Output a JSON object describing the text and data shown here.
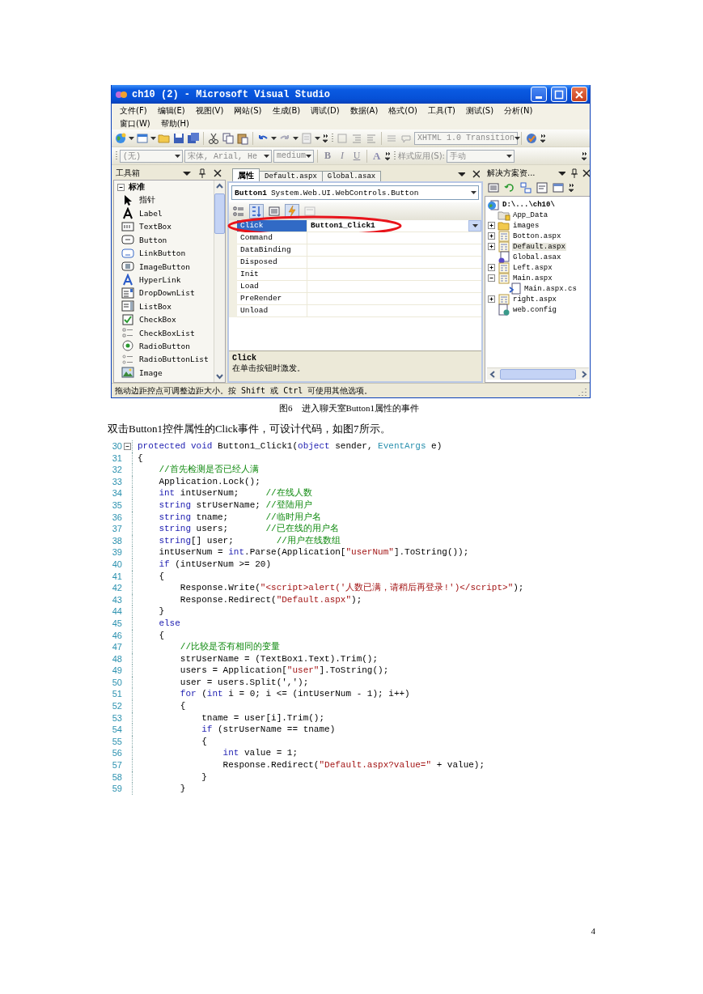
{
  "window": {
    "title": "ch10 (2) - Microsoft Visual Studio",
    "menu_rows": [
      [
        "文件(F)",
        "编辑(E)",
        "视图(V)",
        "网站(S)",
        "生成(B)",
        "调试(D)",
        "数据(A)",
        "格式(O)",
        "工具(T)",
        "测试(S)",
        "分析(N)"
      ],
      [
        "窗口(W)",
        "帮助(H)"
      ]
    ],
    "toolbar": {
      "doctype": {
        "text": "XHTML 1.0 Transition",
        "disabled": true
      }
    },
    "format_bar": {
      "block": {
        "text": "(无)",
        "disabled": true
      },
      "font": {
        "text": "宋体, Arial, He",
        "disabled": true
      },
      "size": {
        "text": "medium",
        "disabled": true
      },
      "buttons": [
        {
          "kind": "bold",
          "label": "B",
          "disabled": true
        },
        {
          "kind": "italic",
          "label": "I",
          "disabled": true
        },
        {
          "kind": "underline",
          "label": "U",
          "disabled": true
        }
      ],
      "font_color": "A",
      "style_label": "样式应用(S):",
      "style_mode": {
        "text": "手动",
        "disabled": true
      }
    },
    "toolbox": {
      "title": "工具箱",
      "group": {
        "label": "标准",
        "expanded": true
      },
      "items": [
        {
          "label": "指针",
          "kind": "pointer"
        },
        {
          "label": "Label",
          "kind": "label"
        },
        {
          "label": "TextBox",
          "kind": "textbox"
        },
        {
          "label": "Button",
          "kind": "button"
        },
        {
          "label": "LinkButton",
          "kind": "linkbutton"
        },
        {
          "label": "ImageButton",
          "kind": "imagebutton"
        },
        {
          "label": "HyperLink",
          "kind": "hyperlink"
        },
        {
          "label": "DropDownList",
          "kind": "dropdownlist"
        },
        {
          "label": "ListBox",
          "kind": "listbox"
        },
        {
          "label": "CheckBox",
          "kind": "checkbox"
        },
        {
          "label": "CheckBoxList",
          "kind": "checkboxlist"
        },
        {
          "label": "RadioButton",
          "kind": "radiobutton"
        },
        {
          "label": "RadioButtonList",
          "kind": "radiobuttonlist"
        },
        {
          "label": "Image",
          "kind": "image"
        }
      ]
    },
    "properties": {
      "tabs": [
        {
          "label": "属性",
          "selected": true
        },
        {
          "label": "Default.aspx",
          "selected": false
        },
        {
          "label": "Global.asax",
          "selected": false
        }
      ],
      "object": {
        "name": "Button1",
        "type": "System.Web.UI.WebControls.Button"
      },
      "toolbar": [
        {
          "kind": "categorized",
          "selected": false,
          "disabled": false
        },
        {
          "kind": "alphabetical",
          "selected": true,
          "disabled": false
        },
        {
          "kind": "properties",
          "selected": false,
          "disabled": false
        },
        {
          "kind": "events",
          "selected": true,
          "disabled": false
        },
        {
          "kind": "property-pages",
          "selected": false,
          "disabled": true
        }
      ],
      "rows": [
        {
          "name": "Click",
          "value": "Button1_Click1",
          "selected": true,
          "circled": true
        },
        {
          "name": "Command",
          "selected": false,
          "circled": false
        },
        {
          "name": "DataBinding",
          "selected": false,
          "circled": false
        },
        {
          "name": "Disposed",
          "selected": false,
          "circled": false
        },
        {
          "name": "Init",
          "selected": false,
          "circled": false
        },
        {
          "name": "Load",
          "selected": false,
          "circled": false
        },
        {
          "name": "PreRender",
          "selected": false,
          "circled": false
        },
        {
          "name": "Unload",
          "selected": false,
          "circled": false
        }
      ],
      "description": {
        "title": "Click",
        "text": "在单击按钮时激发。"
      }
    },
    "solution_explorer": {
      "title": "解决方案资...",
      "root": {
        "label": "D:\\...\\ch10\\",
        "kind": "project",
        "selected": false,
        "children": [
          {
            "label": "App_Data",
            "kind": "data-folder",
            "selected": false
          },
          {
            "label": "images",
            "kind": "folder",
            "expanded": false,
            "selected": false
          },
          {
            "label": "Botton.aspx",
            "kind": "page",
            "expanded": false,
            "selected": false
          },
          {
            "label": "Default.aspx",
            "kind": "page",
            "expanded": false,
            "selected": true
          },
          {
            "label": "Global.asax",
            "kind": "global",
            "selected": false
          },
          {
            "label": "Left.aspx",
            "kind": "page",
            "expanded": false,
            "selected": false
          },
          {
            "label": "Main.aspx",
            "kind": "page",
            "expanded": true,
            "selected": false,
            "children": [
              {
                "label": "Main.aspx.cs",
                "kind": "code",
                "selected": false
              }
            ]
          },
          {
            "label": "right.aspx",
            "kind": "page",
            "expanded": false,
            "selected": false
          },
          {
            "label": "web.config",
            "kind": "config",
            "selected": false
          }
        ]
      }
    },
    "status_bar": "拖动边距控点可调整边距大小。按 Shift 或 Ctrl 可使用其他选项。"
  },
  "caption": "图6　进入聊天室Button1属性的事件",
  "paragraph": "双击Button1控件属性的Click事件，可设计代码，如图7所示。",
  "code": {
    "lines": [
      {
        "number": "30",
        "fold": true,
        "tokens": [
          {
            "kind": "keyword",
            "text": "protected"
          },
          {
            "kind": "keyword",
            "text": " void"
          },
          {
            "kind": "plain",
            "text": " Button1_Click1("
          },
          {
            "kind": "keyword",
            "text": "object"
          },
          {
            "kind": "plain",
            "text": " sender, "
          },
          {
            "kind": "type",
            "text": "EventArgs"
          },
          {
            "kind": "plain",
            "text": " e)"
          }
        ]
      },
      {
        "number": "31",
        "tokens": [
          {
            "kind": "plain",
            "text": "{"
          }
        ]
      },
      {
        "number": "32",
        "tokens": [
          {
            "kind": "comment",
            "text": "    //首先检测是否已经人满"
          }
        ]
      },
      {
        "number": "33",
        "tokens": [
          {
            "kind": "plain",
            "text": "    Application.Lock();"
          }
        ]
      },
      {
        "number": "34",
        "tokens": [
          {
            "kind": "keyword",
            "text": "    int"
          },
          {
            "kind": "plain",
            "text": " intUserNum;     "
          },
          {
            "kind": "comment",
            "text": "//在线人数"
          }
        ]
      },
      {
        "number": "35",
        "tokens": [
          {
            "kind": "keyword",
            "text": "    string"
          },
          {
            "kind": "plain",
            "text": " strUserName; "
          },
          {
            "kind": "comment",
            "text": "//登陆用户"
          }
        ]
      },
      {
        "number": "36",
        "tokens": [
          {
            "kind": "keyword",
            "text": "    string"
          },
          {
            "kind": "plain",
            "text": " tname;       "
          },
          {
            "kind": "comment",
            "text": "//临时用户名"
          }
        ]
      },
      {
        "number": "37",
        "tokens": [
          {
            "kind": "keyword",
            "text": "    string"
          },
          {
            "kind": "plain",
            "text": " users;       "
          },
          {
            "kind": "comment",
            "text": "//已在线的用户名"
          }
        ]
      },
      {
        "number": "38",
        "tokens": [
          {
            "kind": "keyword",
            "text": "    string"
          },
          {
            "kind": "plain",
            "text": "[] user;        "
          },
          {
            "kind": "comment",
            "text": "//用户在线数组"
          }
        ]
      },
      {
        "number": "39",
        "tokens": [
          {
            "kind": "plain",
            "text": "    intUserNum = "
          },
          {
            "kind": "keyword",
            "text": "int"
          },
          {
            "kind": "plain",
            "text": ".Parse(Application["
          },
          {
            "kind": "string",
            "text": "\"userNum\""
          },
          {
            "kind": "plain",
            "text": "].ToString());"
          }
        ]
      },
      {
        "number": "40",
        "tokens": [
          {
            "kind": "keyword",
            "text": "    if"
          },
          {
            "kind": "plain",
            "text": " (intUserNum >= 20)"
          }
        ]
      },
      {
        "number": "41",
        "tokens": [
          {
            "kind": "plain",
            "text": "    {"
          }
        ]
      },
      {
        "number": "42",
        "tokens": [
          {
            "kind": "plain",
            "text": "        Response.Write("
          },
          {
            "kind": "string",
            "text": "\"<script>alert('人数已满，请稍后再登录!')</script>\""
          },
          {
            "kind": "plain",
            "text": ");"
          }
        ]
      },
      {
        "number": "43",
        "tokens": [
          {
            "kind": "plain",
            "text": "        Response.Redirect("
          },
          {
            "kind": "string",
            "text": "\"Default.aspx\""
          },
          {
            "kind": "plain",
            "text": ");"
          }
        ]
      },
      {
        "number": "44",
        "tokens": [
          {
            "kind": "plain",
            "text": "    }"
          }
        ]
      },
      {
        "number": "45",
        "tokens": [
          {
            "kind": "keyword",
            "text": "    else"
          }
        ]
      },
      {
        "number": "46",
        "tokens": [
          {
            "kind": "plain",
            "text": "    {"
          }
        ]
      },
      {
        "number": "47",
        "tokens": [
          {
            "kind": "comment",
            "text": "        //比较是否有相同的变量"
          }
        ]
      },
      {
        "number": "48",
        "tokens": [
          {
            "kind": "plain",
            "text": "        strUserName = (TextBox1.Text).Trim();"
          }
        ]
      },
      {
        "number": "49",
        "tokens": [
          {
            "kind": "plain",
            "text": "        users = Application["
          },
          {
            "kind": "string",
            "text": "\"user\""
          },
          {
            "kind": "plain",
            "text": "].ToString();"
          }
        ]
      },
      {
        "number": "50",
        "tokens": [
          {
            "kind": "plain",
            "text": "        user = users.Split(',');"
          }
        ]
      },
      {
        "number": "51",
        "tokens": [
          {
            "kind": "keyword",
            "text": "        for"
          },
          {
            "kind": "plain",
            "text": " ("
          },
          {
            "kind": "keyword",
            "text": "int"
          },
          {
            "kind": "plain",
            "text": " i = 0; i <= (intUserNum - 1); i++)"
          }
        ]
      },
      {
        "number": "52",
        "tokens": [
          {
            "kind": "plain",
            "text": "        {"
          }
        ]
      },
      {
        "number": "53",
        "tokens": [
          {
            "kind": "plain",
            "text": "            tname = user[i].Trim();"
          }
        ]
      },
      {
        "number": "54",
        "tokens": [
          {
            "kind": "keyword",
            "text": "            if"
          },
          {
            "kind": "plain",
            "text": " (strUserName == tname)"
          }
        ]
      },
      {
        "number": "55",
        "tokens": [
          {
            "kind": "plain",
            "text": "            {"
          }
        ]
      },
      {
        "number": "56",
        "tokens": [
          {
            "kind": "keyword",
            "text": "                int"
          },
          {
            "kind": "plain",
            "text": " value = 1;"
          }
        ]
      },
      {
        "number": "57",
        "tokens": [
          {
            "kind": "plain",
            "text": "                Response.Redirect("
          },
          {
            "kind": "string",
            "text": "\"Default.aspx?value=\""
          },
          {
            "kind": "plain",
            "text": " + value);"
          }
        ]
      },
      {
        "number": "58",
        "tokens": [
          {
            "kind": "plain",
            "text": "            }"
          }
        ]
      },
      {
        "number": "59",
        "tokens": [
          {
            "kind": "plain",
            "text": "        }"
          }
        ]
      }
    ]
  },
  "page_number": "4"
}
